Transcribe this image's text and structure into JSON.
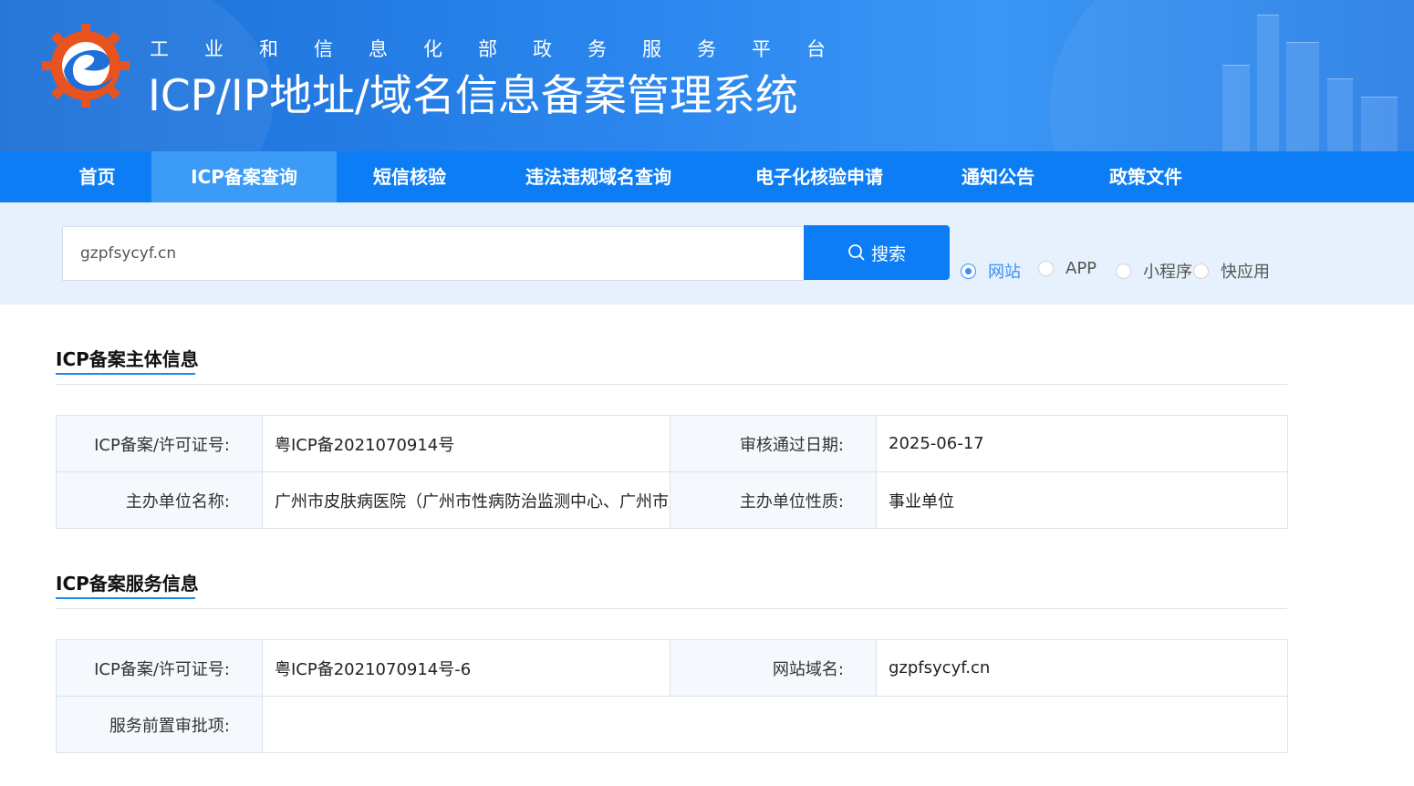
{
  "header": {
    "org_name": "工业和信息化部政务服务平台",
    "system_title": "ICP/IP地址/域名信息备案管理系统"
  },
  "nav": {
    "items": [
      "首页",
      "ICP备案查询",
      "短信核验",
      "违法违规域名查询",
      "电子化核验申请",
      "通知公告",
      "政策文件"
    ],
    "active": "ICP备案查询"
  },
  "search": {
    "value": "gzpfsycyf.cn",
    "button_label": "搜索",
    "types": [
      "网站",
      "APP",
      "小程序",
      "快应用"
    ],
    "selected_type": "网站"
  },
  "subject_info": {
    "title": "ICP备案主体信息",
    "license_label": "ICP备案/许可证号:",
    "license_value": "粤ICP备2021070914号",
    "approve_date_label": "审核通过日期:",
    "approve_date_value": "2025-06-17",
    "org_name_label": "主办单位名称:",
    "org_name_value": "广州市皮肤病医院（广州市性病防治监测中心、广州市皮",
    "org_type_label": "主办单位性质:",
    "org_type_value": "事业单位"
  },
  "service_info": {
    "title": "ICP备案服务信息",
    "license_label": "ICP备案/许可证号:",
    "license_value": "粤ICP备2021070914号-6",
    "domain_label": "网站域名:",
    "domain_value": "gzpfsycyf.cn",
    "pre_approval_label": "服务前置审批项:",
    "pre_approval_value": ""
  },
  "colors": {
    "nav_bg": "#0c7df4",
    "nav_active": "#3b9bf6",
    "accent": "#1f86f0",
    "search_strip": "#e6f1fd"
  }
}
